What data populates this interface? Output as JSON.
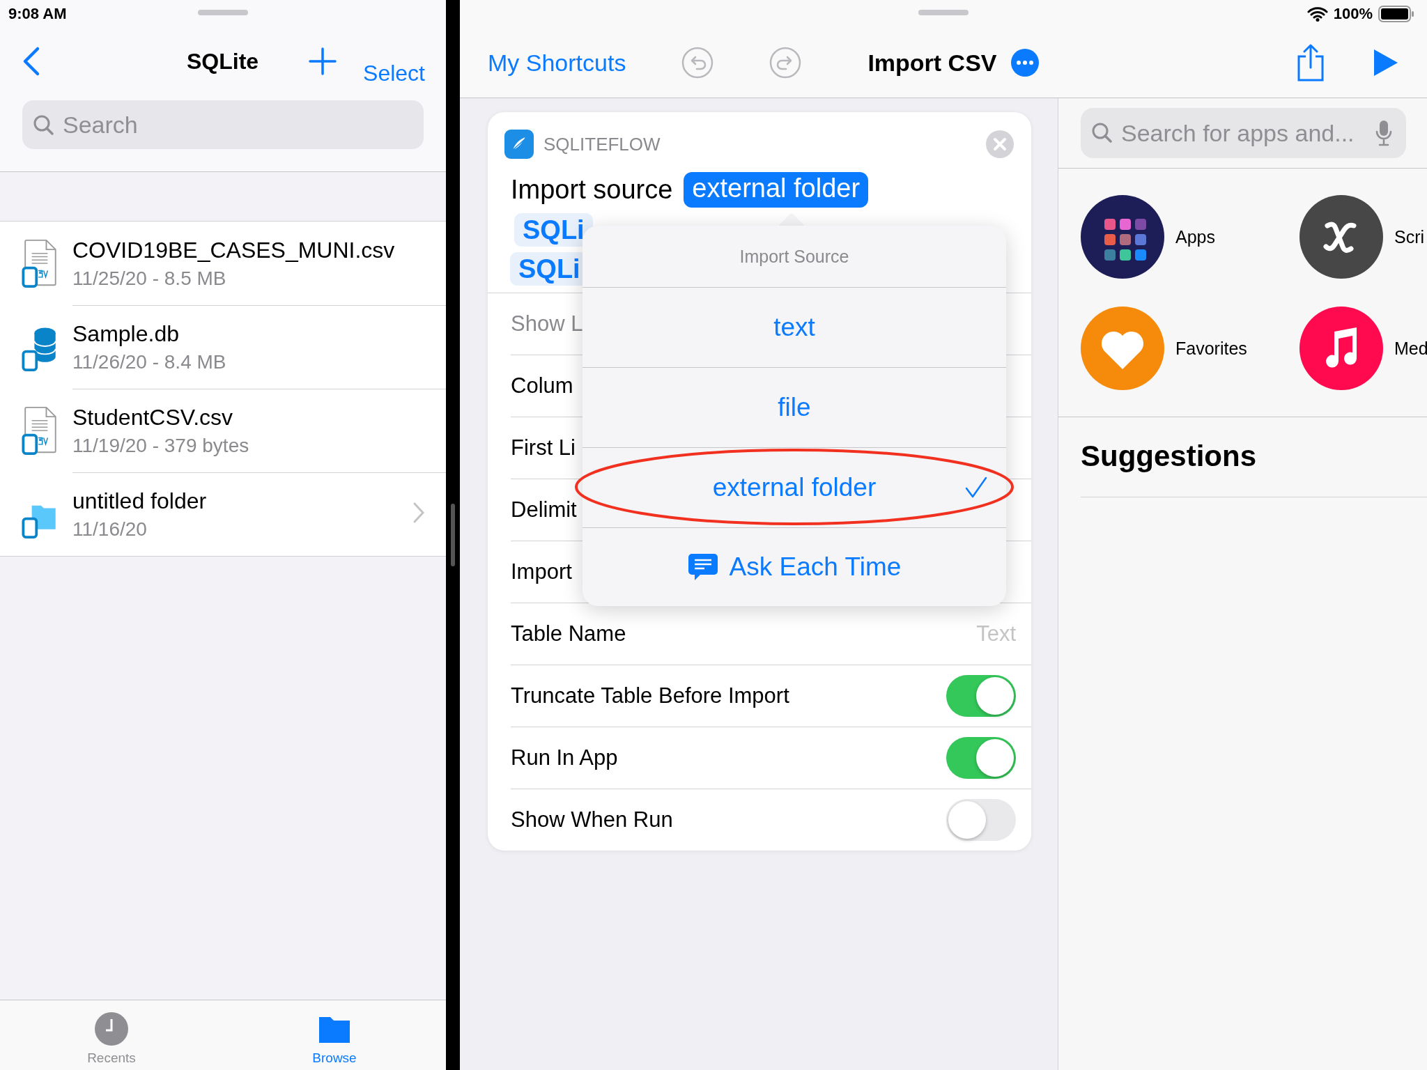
{
  "status_bar": {
    "time": "9:08 AM",
    "battery": "100%"
  },
  "files_pane": {
    "title": "SQLite",
    "select": "Select",
    "search": {
      "placeholder": "Search"
    },
    "items": [
      {
        "kind": "csv",
        "name": "COVID19BE_CASES_MUNI.csv",
        "details": "11/25/20 - 8.5 MB",
        "has_children": false
      },
      {
        "kind": "database",
        "name": "Sample.db",
        "details": "11/26/20 - 8.4 MB",
        "has_children": false
      },
      {
        "kind": "csv",
        "name": "StudentCSV.csv",
        "details": "11/19/20 - 379 bytes",
        "has_children": false
      },
      {
        "kind": "folder",
        "name": "untitled folder",
        "details": "11/16/20",
        "has_children": true
      }
    ],
    "tab_bar": [
      {
        "kind": "recents",
        "label": "Recents",
        "selected": false
      },
      {
        "kind": "browse",
        "label": "Browse",
        "selected": true
      }
    ]
  },
  "shortcut_toolbar": {
    "back": "My Shortcuts",
    "title": "Import CSV"
  },
  "action_card": {
    "app": "SQLITEFLOW",
    "parameter_label": "Import source",
    "parameter_value": "external folder",
    "tokens": [
      "SQLi",
      "SQLi"
    ],
    "rows": [
      {
        "kind": "label",
        "label": "Show L",
        "dimmed": true
      },
      {
        "kind": "label",
        "label": "Colum",
        "dimmed": false
      },
      {
        "kind": "label",
        "label": "First Li",
        "dimmed": false
      },
      {
        "kind": "label",
        "label": "Delimit",
        "dimmed": false
      },
      {
        "kind": "label",
        "label": "Import",
        "dimmed": false
      },
      {
        "kind": "text",
        "label": "Table Name",
        "placeholder": "Text"
      },
      {
        "kind": "toggle",
        "label": "Truncate Table Before Import",
        "on": true
      },
      {
        "kind": "toggle",
        "label": "Run In App",
        "on": true
      },
      {
        "kind": "toggle",
        "label": "Show When Run",
        "on": false
      }
    ]
  },
  "popover": {
    "title": "Import Source",
    "options": [
      {
        "label": "text",
        "selected": false
      },
      {
        "label": "file",
        "selected": false
      },
      {
        "label": "external folder",
        "selected": true
      }
    ],
    "ask_each_time": "Ask Each Time"
  },
  "library": {
    "search": {
      "placeholder": "Search for apps and..."
    },
    "categories": [
      {
        "kind": "apps",
        "label": "Apps"
      },
      {
        "kind": "scripting",
        "label": "Scri"
      },
      {
        "kind": "favorites",
        "label": "Favorites"
      },
      {
        "kind": "media",
        "label": "Med"
      }
    ],
    "heading": "Suggestions"
  }
}
